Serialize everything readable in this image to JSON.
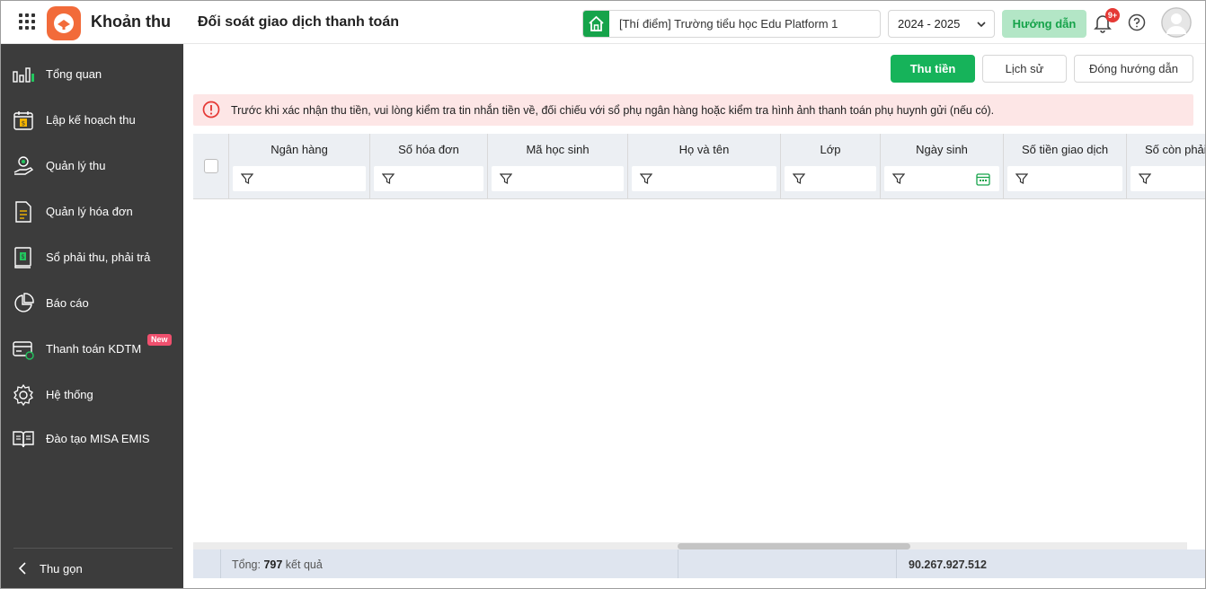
{
  "header": {
    "app_name": "Khoản thu",
    "page_title": "Đối soát giao dịch thanh toán",
    "school": "[Thí điểm] Trường tiểu học Edu Platform 1",
    "school_year": "2024 - 2025",
    "guide_label": "Hướng dẫn",
    "notification_count": "9+"
  },
  "sidebar": {
    "items": [
      {
        "label": "Tổng quan",
        "icon": "chart-bar-icon"
      },
      {
        "label": "Lập kế hoạch thu",
        "icon": "calendar-money-icon"
      },
      {
        "label": "Quản lý thu",
        "icon": "hand-coin-icon"
      },
      {
        "label": "Quản lý hóa đơn",
        "icon": "invoice-icon"
      },
      {
        "label": "Sổ phải thu, phải trả",
        "icon": "ledger-icon"
      },
      {
        "label": "Báo cáo",
        "icon": "pie-chart-icon"
      },
      {
        "label": "Thanh toán KDTM",
        "icon": "card-payment-icon",
        "badge": "New"
      },
      {
        "label": "Hệ thống",
        "icon": "gear-icon"
      },
      {
        "label": "Đào tạo MISA EMIS",
        "icon": "book-icon"
      }
    ],
    "collapse_label": "Thu gọn"
  },
  "toolbar": {
    "collect_label": "Thu tiền",
    "history_label": "Lịch sử",
    "close_guide_label": "Đóng hướng dẫn"
  },
  "alert": {
    "text": "Trước khi xác nhận thu tiền, vui lòng kiểm tra tin nhắn tiền về, đối chiếu với sổ phụ ngân hàng hoặc kiểm tra hình ảnh thanh toán phụ huynh gửi (nếu có)."
  },
  "table": {
    "columns": [
      "Ngân hàng",
      "Số hóa đơn",
      "Mã học sinh",
      "Họ và tên",
      "Lớp",
      "Ngày sinh",
      "Số tiền giao dịch",
      "Số còn phải"
    ],
    "rows": []
  },
  "footer": {
    "total_prefix": "Tổng:",
    "total_count": "797",
    "total_suffix": "kết quả",
    "sum_amount": "90.267.927.512"
  },
  "colors": {
    "accent_green": "#16b35a",
    "sidebar_bg": "#3c3c3c",
    "alert_bg": "#fde6e6",
    "logo_orange": "#f26b3a"
  }
}
